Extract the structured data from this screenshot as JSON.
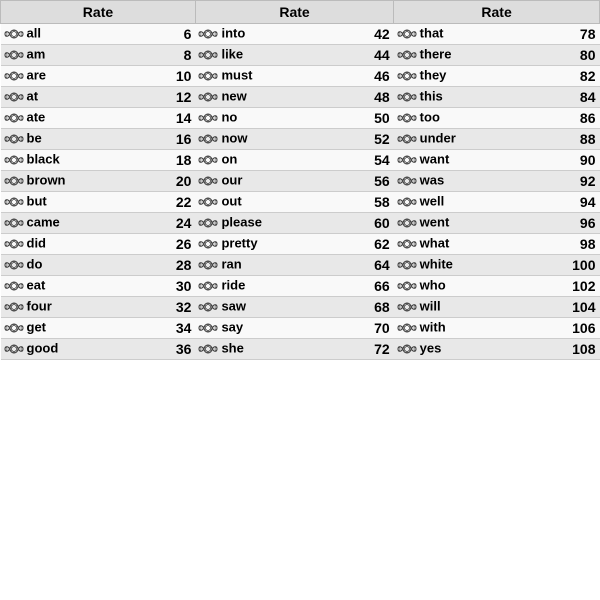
{
  "columns": [
    {
      "items": [
        {
          "word": "all",
          "num": 6
        },
        {
          "word": "am",
          "num": 8
        },
        {
          "word": "are",
          "num": 10
        },
        {
          "word": "at",
          "num": 12
        },
        {
          "word": "ate",
          "num": 14
        },
        {
          "word": "be",
          "num": 16
        },
        {
          "word": "black",
          "num": 18
        },
        {
          "word": "brown",
          "num": 20
        },
        {
          "word": "but",
          "num": 22
        },
        {
          "word": "came",
          "num": 24
        },
        {
          "word": "did",
          "num": 26
        },
        {
          "word": "do",
          "num": 28
        },
        {
          "word": "eat",
          "num": 30
        },
        {
          "word": "four",
          "num": 32
        },
        {
          "word": "get",
          "num": 34
        },
        {
          "word": "good",
          "num": 36
        }
      ]
    },
    {
      "items": [
        {
          "word": "into",
          "num": 42
        },
        {
          "word": "like",
          "num": 44
        },
        {
          "word": "must",
          "num": 46
        },
        {
          "word": "new",
          "num": 48
        },
        {
          "word": "no",
          "num": 50
        },
        {
          "word": "now",
          "num": 52
        },
        {
          "word": "on",
          "num": 54
        },
        {
          "word": "our",
          "num": 56
        },
        {
          "word": "out",
          "num": 58
        },
        {
          "word": "please",
          "num": 60
        },
        {
          "word": "pretty",
          "num": 62
        },
        {
          "word": "ran",
          "num": 64
        },
        {
          "word": "ride",
          "num": 66
        },
        {
          "word": "saw",
          "num": 68
        },
        {
          "word": "say",
          "num": 70
        },
        {
          "word": "she",
          "num": 72
        }
      ]
    },
    {
      "items": [
        {
          "word": "that",
          "num": 78
        },
        {
          "word": "there",
          "num": 80
        },
        {
          "word": "they",
          "num": 82
        },
        {
          "word": "this",
          "num": 84
        },
        {
          "word": "too",
          "num": 86
        },
        {
          "word": "under",
          "num": 88
        },
        {
          "word": "want",
          "num": 90
        },
        {
          "word": "was",
          "num": 92
        },
        {
          "word": "well",
          "num": 94
        },
        {
          "word": "went",
          "num": 96
        },
        {
          "word": "what",
          "num": 98
        },
        {
          "word": "white",
          "num": 100
        },
        {
          "word": "who",
          "num": 102
        },
        {
          "word": "will",
          "num": 104
        },
        {
          "word": "with",
          "num": 106
        },
        {
          "word": "yes",
          "num": 108
        }
      ]
    }
  ],
  "header": "Rate"
}
